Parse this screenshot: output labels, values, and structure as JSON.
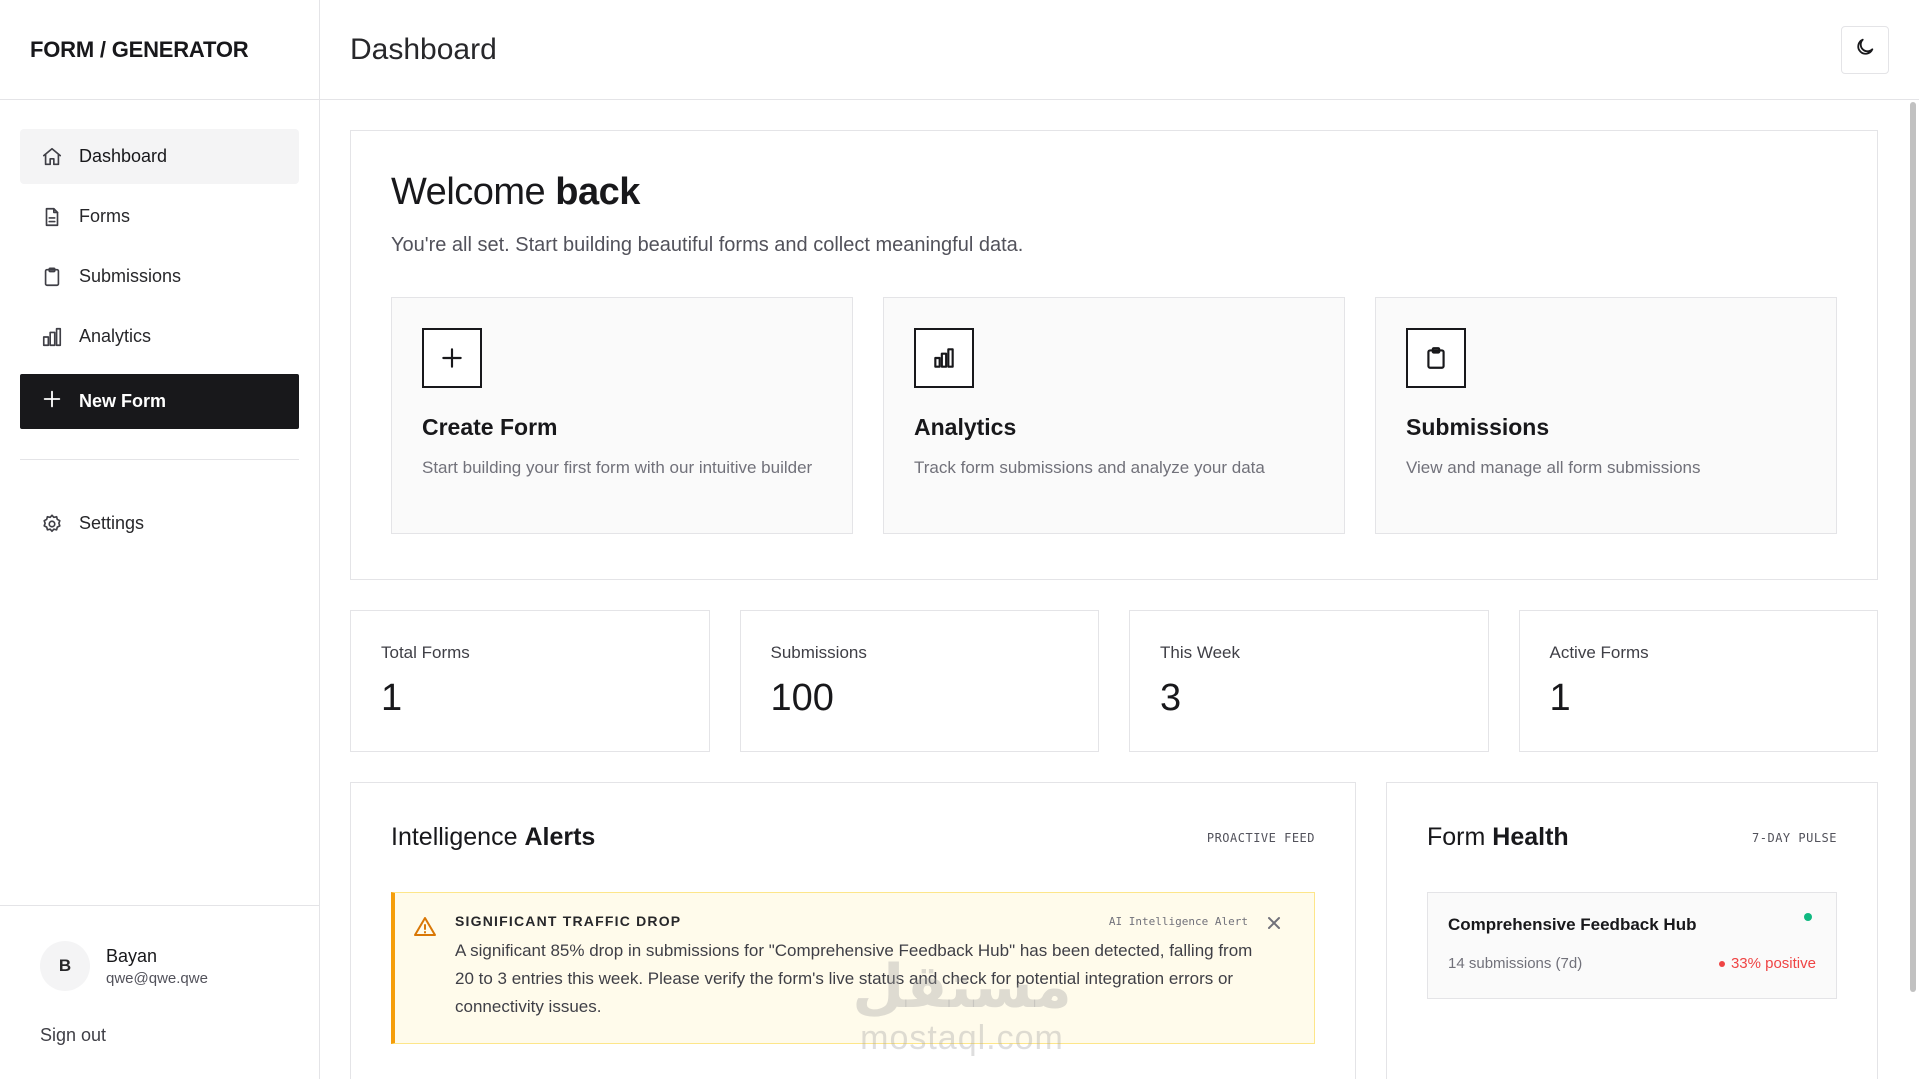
{
  "brand": "FORM / GENERATOR",
  "header": {
    "title": "Dashboard"
  },
  "sidebar": {
    "items": [
      {
        "label": "Dashboard"
      },
      {
        "label": "Forms"
      },
      {
        "label": "Submissions"
      },
      {
        "label": "Analytics"
      }
    ],
    "new_form": "New Form",
    "settings": "Settings"
  },
  "user": {
    "initial": "B",
    "name": "Bayan",
    "email": "qwe@qwe.qwe",
    "signout": "Sign out"
  },
  "welcome": {
    "title_regular": "Welcome ",
    "title_bold": "back",
    "subtitle": "You're all set. Start building beautiful forms and collect meaningful data."
  },
  "cards": [
    {
      "icon": "plus-icon",
      "title": "Create Form",
      "desc": "Start building your first form with our intuitive builder"
    },
    {
      "icon": "bar-chart-icon",
      "title": "Analytics",
      "desc": "Track form submissions and analyze your data"
    },
    {
      "icon": "clipboard-icon",
      "title": "Submissions",
      "desc": "View and manage all form submissions"
    }
  ],
  "stats": [
    {
      "label": "Total Forms",
      "value": "1"
    },
    {
      "label": "Submissions",
      "value": "100"
    },
    {
      "label": "This Week",
      "value": "3"
    },
    {
      "label": "Active Forms",
      "value": "1"
    }
  ],
  "alerts": {
    "title_regular": "Intelligence ",
    "title_bold": "Alerts",
    "tag": "PROACTIVE FEED",
    "item": {
      "title": "SIGNIFICANT TRAFFIC DROP",
      "source": "AI Intelligence Alert",
      "text": "A significant 85% drop in submissions for \"Comprehensive Feedback Hub\" has been detected, falling from 20 to 3 entries this week. Please verify the form's live status and check for potential integration errors or connectivity issues."
    }
  },
  "health": {
    "title_regular": "Form ",
    "title_bold": "Health",
    "tag": "7-DAY PULSE",
    "form": {
      "name": "Comprehensive Feedback Hub",
      "submissions": "14 submissions (7d)",
      "sentiment": "33% positive"
    }
  },
  "watermark": {
    "arabic": "مستقل",
    "latin": "mostaql.com"
  },
  "colors": {
    "accent_dark": "#18181b",
    "alert_amber": "#f59e0b",
    "status_green": "#10b981",
    "status_red": "#ef4444"
  }
}
